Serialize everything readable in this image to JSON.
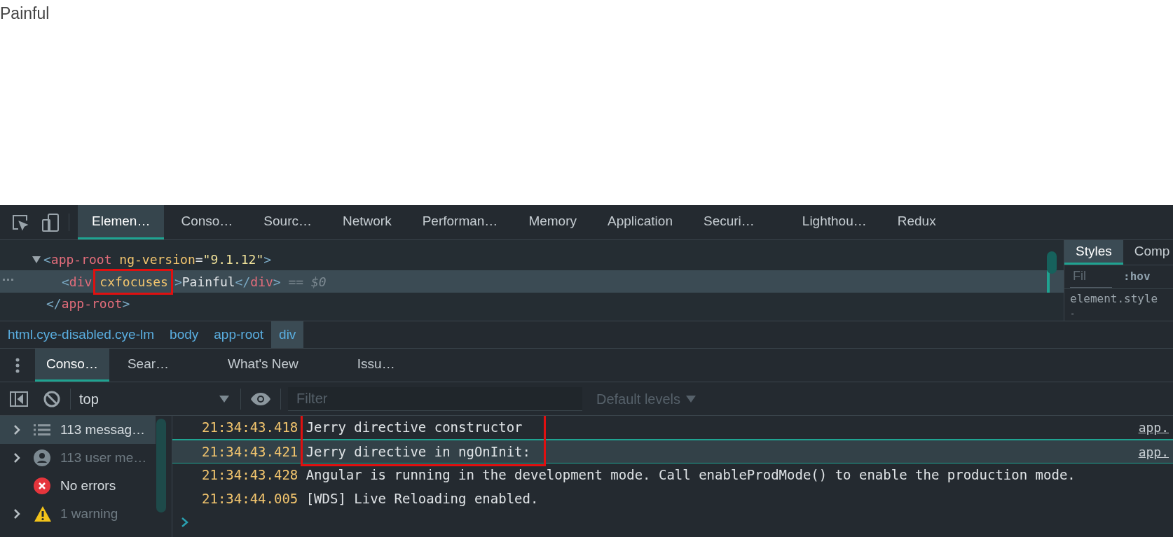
{
  "page": {
    "text": "Painful"
  },
  "devtools": {
    "tabs": [
      {
        "label": "Elemen…",
        "selected": true
      },
      {
        "label": "Conso…",
        "selected": false
      },
      {
        "label": "Sourc…",
        "selected": false
      },
      {
        "label": "Network",
        "selected": false
      },
      {
        "label": "Performan…",
        "selected": false
      },
      {
        "label": "Memory",
        "selected": false
      },
      {
        "label": "Application",
        "selected": false
      },
      {
        "label": "Securi…",
        "selected": false
      },
      {
        "label": "Lighthou…",
        "selected": false
      },
      {
        "label": "Redux",
        "selected": false
      }
    ],
    "elements_tree": [
      {
        "expanded": true,
        "selected": false,
        "open": [
          {
            "kind": "bracket",
            "text": "<"
          },
          {
            "kind": "tag",
            "text": "app-root"
          },
          {
            "kind": "attr",
            "text": "ng-version"
          },
          {
            "kind": "plain",
            "text": "="
          },
          {
            "kind": "value",
            "text": "\"9.1.12\""
          },
          {
            "kind": "bracket",
            "text": ">"
          }
        ],
        "children": [
          {
            "selected": true,
            "open": [
              {
                "kind": "bracket",
                "text": "<"
              },
              {
                "kind": "tag",
                "text": "div"
              },
              {
                "kind": "attr",
                "text": "cxfocuses",
                "boxed": true
              },
              {
                "kind": "bracket",
                "text": ">"
              },
              {
                "kind": "plain",
                "text": "Painful"
              },
              {
                "kind": "bracket",
                "text": "</"
              },
              {
                "kind": "tag",
                "text": "div"
              },
              {
                "kind": "bracket",
                "text": ">"
              },
              {
                "kind": "ref",
                "text": "== $0"
              }
            ]
          }
        ],
        "close": [
          {
            "kind": "bracket",
            "text": "</"
          },
          {
            "kind": "tag",
            "text": "app-root"
          },
          {
            "kind": "bracket",
            "text": ">"
          }
        ]
      }
    ],
    "breadcrumbs": [
      {
        "label": "html.cye-disabled.cye-lm",
        "selected": false
      },
      {
        "label": "body",
        "selected": false
      },
      {
        "label": "app-root",
        "selected": false
      },
      {
        "label": "div",
        "selected": true
      }
    ],
    "styles_panel": {
      "tabs": [
        {
          "label": "Styles",
          "selected": true
        },
        {
          "label": "Comp",
          "selected": false
        }
      ],
      "filter": {
        "placeholder": "Fil"
      },
      "hov": ":hov",
      "rule": "element.style",
      "rule_body": "-"
    },
    "drawer_tabs": [
      {
        "label": "Conso…",
        "selected": true
      },
      {
        "label": "Sear…",
        "selected": false
      },
      {
        "label": "What's New",
        "selected": false
      },
      {
        "label": "Issu…",
        "selected": false
      }
    ],
    "console_toolbar": {
      "context": "top",
      "filter": {
        "placeholder": "Filter"
      },
      "levels": "Default levels"
    },
    "sidebar": [
      {
        "kind": "messages",
        "label": "113 messag…",
        "selected": true,
        "expandable": true,
        "dimmed": false
      },
      {
        "kind": "user",
        "label": "113 user me…",
        "selected": false,
        "expandable": true,
        "dimmed": true
      },
      {
        "kind": "error",
        "label": "No errors",
        "selected": false,
        "expandable": false,
        "dimmed": false
      },
      {
        "kind": "warning",
        "label": "1 warning",
        "selected": false,
        "expandable": true,
        "dimmed": true
      }
    ],
    "messages": [
      {
        "time": "21:34:43.418",
        "text": "Jerry directive constructor",
        "source": "app.",
        "selected": false,
        "boxed": true
      },
      {
        "time": "21:34:43.421",
        "text": "Jerry directive in ngOnInit:",
        "source": "app.",
        "selected": true,
        "boxed": true
      },
      {
        "time": "21:34:43.428",
        "text": "Angular is running in the development mode. Call enableProdMode() to enable the production mode.",
        "selected": false
      },
      {
        "time": "21:34:44.005",
        "text": "[WDS] Live Reloading enabled.",
        "selected": false
      }
    ]
  }
}
